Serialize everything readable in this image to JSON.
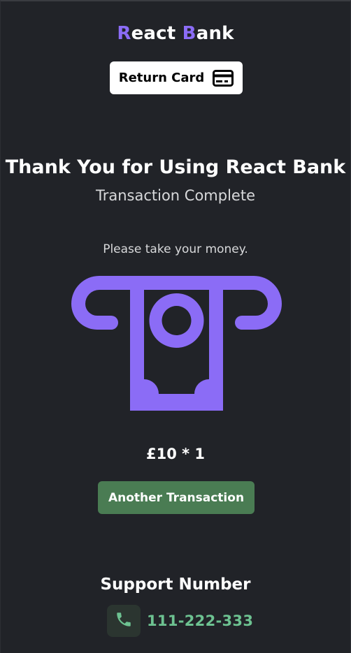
{
  "brand": {
    "first_initial": "R",
    "first_rest": "eact",
    "space": " ",
    "second_initial": "B",
    "second_rest": "ank",
    "accent_color": "#8b6cf6"
  },
  "header": {
    "return_card_label": "Return Card",
    "return_card_icon": "credit-card-icon"
  },
  "main": {
    "title": "Thank You for Using React Bank",
    "subtitle": "Transaction Complete",
    "instruction": "Please take your money.",
    "dispense_icon": "atm-cash-dispense-icon",
    "amount": "£10 * 1",
    "another_transaction_label": "Another Transaction"
  },
  "support": {
    "title": "Support Number",
    "phone_icon": "phone-icon",
    "phone_number": "111-222-333"
  },
  "colors": {
    "background": "#212328",
    "accent_purple": "#8b6cf6",
    "button_green": "#4a7c53",
    "phone_green": "#6dc291"
  }
}
